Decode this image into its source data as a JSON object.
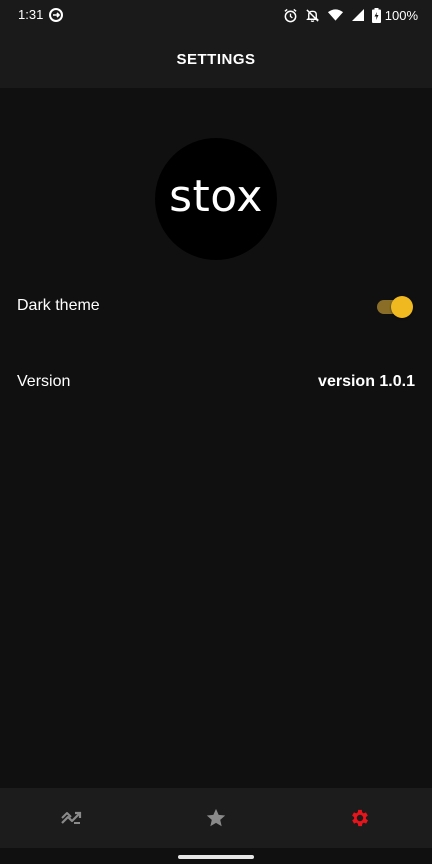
{
  "status_bar": {
    "time": "1:31",
    "battery": "100%",
    "icons": [
      "sync-icon",
      "alarm-icon",
      "notifications-off-icon",
      "wifi-icon",
      "signal-icon",
      "battery-icon"
    ]
  },
  "header": {
    "title": "SETTINGS"
  },
  "logo": {
    "text": "stox"
  },
  "settings": {
    "dark_theme": {
      "label": "Dark theme",
      "enabled": true
    },
    "version": {
      "label": "Version",
      "value": "version 1.0.1"
    }
  },
  "bottom_nav": {
    "items": [
      {
        "icon": "trending-icon",
        "active": false
      },
      {
        "icon": "star-icon",
        "active": false
      },
      {
        "icon": "gear-icon",
        "active": true
      }
    ]
  },
  "colors": {
    "background": "#101010",
    "bar": "#1a1a1a",
    "accent": "#f0b91f",
    "active_nav": "#e8141b",
    "inactive_nav": "#8a8a8a"
  }
}
